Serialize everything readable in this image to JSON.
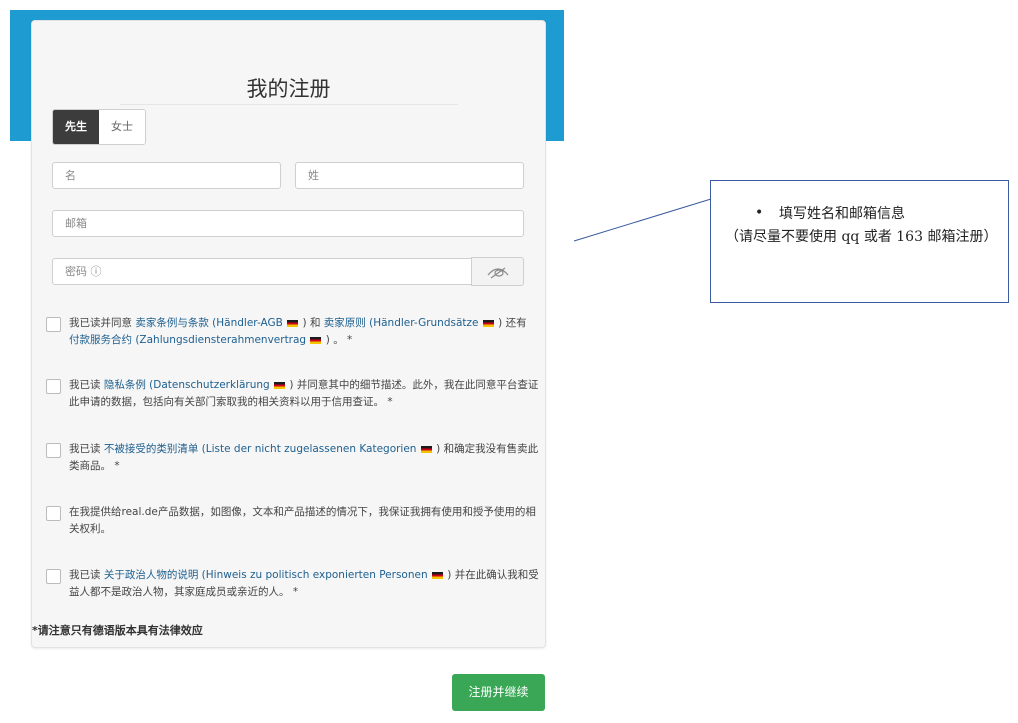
{
  "form": {
    "title": "我的注册",
    "gender_options": [
      "先生",
      "女士"
    ],
    "first_name_placeholder": "名",
    "last_name_placeholder": "姓",
    "email_placeholder": "邮箱",
    "password_placeholder": "密码 ⓘ",
    "agreements": [
      {
        "parts": [
          {
            "t": "我已读并同意 ",
            "link": false
          },
          {
            "t": "卖家条例与条款",
            "link": true
          },
          {
            "t": " (Händler-AGB ",
            "link": true,
            "flag": true
          },
          {
            "t": " ) 和 ",
            "link": false
          },
          {
            "t": "卖家原则",
            "link": true
          },
          {
            "t": " (Händler-Grundsätze ",
            "link": true,
            "flag": true
          },
          {
            "t": " ) 还有 ",
            "link": false
          },
          {
            "t": "付款服务合约",
            "link": true
          },
          {
            "t": " (Zahlungsdiensterahmenvertrag ",
            "link": true,
            "flag": true
          },
          {
            "t": " ) 。 *",
            "link": false
          }
        ]
      },
      {
        "parts": [
          {
            "t": "我已读 ",
            "link": false
          },
          {
            "t": "隐私条例",
            "link": true
          },
          {
            "t": " (Datenschutzerklärung ",
            "link": true,
            "flag": true
          },
          {
            "t": " ) 并同意其中的细节描述。此外，我在此同意平台查证此申请的数据，包括向有关部门索取我的相关资料以用于信用查证。 *",
            "link": false
          }
        ]
      },
      {
        "parts": [
          {
            "t": "我已读 ",
            "link": false
          },
          {
            "t": "不被接受的类别清单",
            "link": true
          },
          {
            "t": " (Liste der nicht zugelassenen Kategorien ",
            "link": true,
            "flag": true
          },
          {
            "t": " ) 和确定我没有售卖此类商品。 *",
            "link": false
          }
        ]
      },
      {
        "parts": [
          {
            "t": "在我提供给real.de产品数据，如图像，文本和产品描述的情况下，我保证我拥有使用和授予使用的相关权利。",
            "link": false
          }
        ]
      },
      {
        "parts": [
          {
            "t": "我已读 ",
            "link": false
          },
          {
            "t": "关于政治人物的说明",
            "link": true
          },
          {
            "t": " (Hinweis zu politisch exponierten Personen ",
            "link": true,
            "flag": true
          },
          {
            "t": " ) 并在此确认我和受益人都不是政治人物，其家庭成员或亲近的人。 *",
            "link": false
          }
        ]
      }
    ],
    "legal_note": "*请注意只有德语版本具有法律效应",
    "submit_label": "注册并继续"
  },
  "callout": {
    "bullet": "•",
    "main": "填写姓名和邮箱信息",
    "sub": "（请尽量不要使用 qq 或者 163 邮箱注册）"
  },
  "colors": {
    "accent_blue": "#1e9bd1",
    "submit_green": "#3aa757",
    "link_blue": "#1d5f8f",
    "callout_border": "#3b5aa0"
  }
}
